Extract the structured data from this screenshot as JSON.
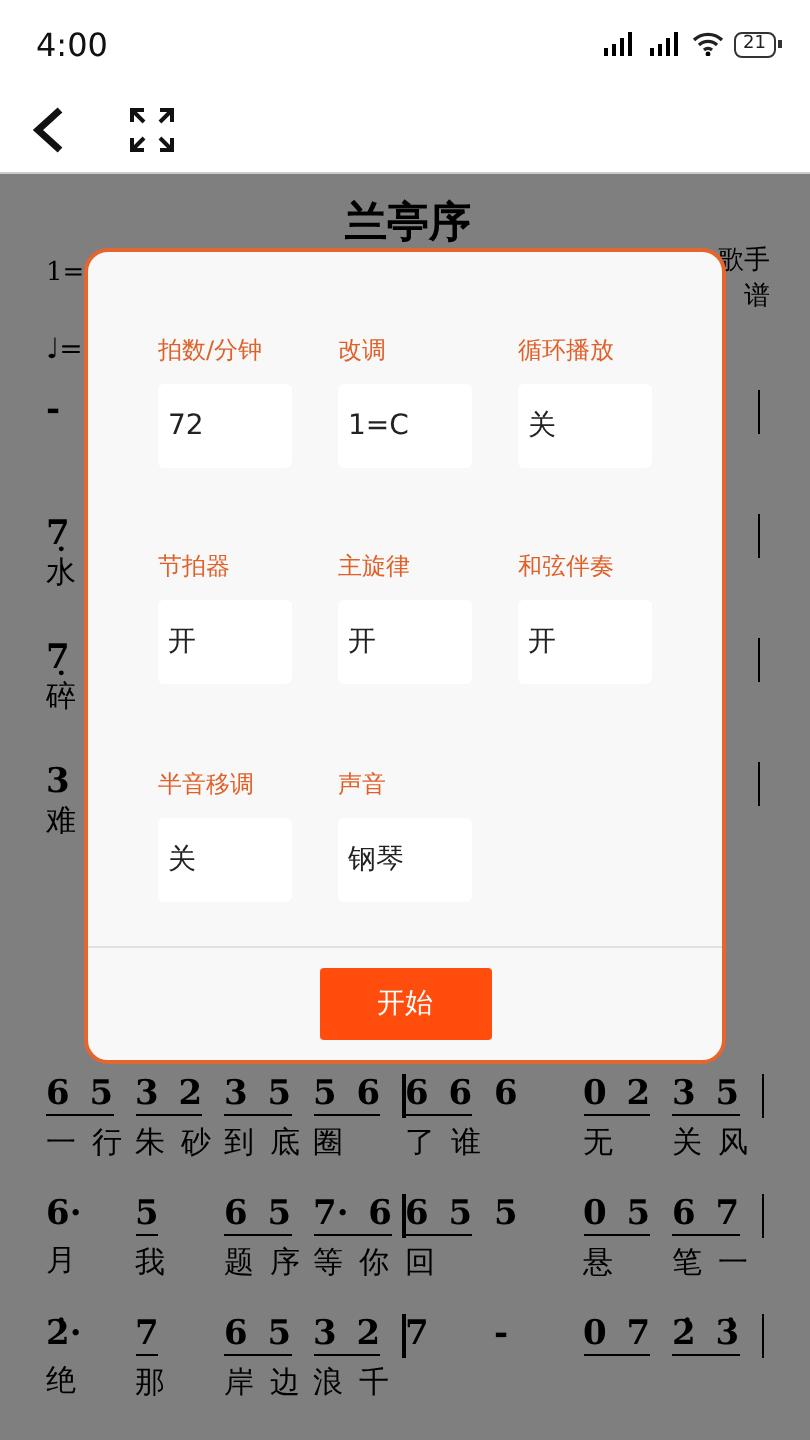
{
  "status_bar": {
    "time": "4:00",
    "battery": "21"
  },
  "score": {
    "title": "兰亭序",
    "key": "1=",
    "tempo": "♩=",
    "credits": [
      "歌手",
      "谱"
    ],
    "fragments": [
      {
        "note": "-"
      },
      {
        "note": "7̣",
        "lyric": "水"
      },
      {
        "note": "7̣",
        "lyric": "碎"
      },
      {
        "note": "3",
        "lyric": "难"
      }
    ],
    "lines": [
      {
        "cells": [
          {
            "notes": "6 5",
            "beam": true,
            "lyric": "一 行"
          },
          {
            "notes": "3 2",
            "beam": true,
            "lyric": "朱 砂"
          },
          {
            "notes": "3 5",
            "beam": true,
            "lyric": "到 底"
          },
          {
            "notes": "5 6",
            "beam": true,
            "lyric": "圈"
          },
          {
            "kind": "bar"
          },
          {
            "notes": "6 6",
            "beam": true,
            "lyric": "了 谁"
          },
          {
            "notes": "6",
            "beam": false
          },
          {
            "notes": "0 2",
            "beam": true,
            "lyric": "无"
          },
          {
            "notes": "3 5",
            "beam": true,
            "lyric": "关 风"
          },
          {
            "kind": "bar"
          }
        ]
      },
      {
        "cells": [
          {
            "notes": "6·",
            "beam": false,
            "lyric": "月"
          },
          {
            "notes": "5",
            "beam": true,
            "lyric": "我"
          },
          {
            "notes": "6 5",
            "beam": true,
            "lyric": "题 序"
          },
          {
            "notes": "7· 6",
            "beam": true,
            "lyric": "等 你"
          },
          {
            "kind": "bar"
          },
          {
            "notes": "6 5",
            "beam": true,
            "lyric": "回"
          },
          {
            "notes": "5",
            "beam": false
          },
          {
            "notes": "0 5",
            "beam": true,
            "lyric": "悬"
          },
          {
            "notes": "6 7",
            "beam": true,
            "lyric": "笔 一"
          },
          {
            "kind": "bar"
          }
        ]
      },
      {
        "cells": [
          {
            "notes": "2̇·",
            "beam": false,
            "lyric": "绝"
          },
          {
            "notes": "7",
            "beam": true,
            "lyric": "那"
          },
          {
            "notes": "6 5",
            "beam": true,
            "lyric": "岸 边"
          },
          {
            "notes": "3 2",
            "beam": true,
            "lyric": "浪 千"
          },
          {
            "kind": "bar"
          },
          {
            "notes": "7",
            "beam": false
          },
          {
            "notes": "-",
            "beam": false
          },
          {
            "notes": "0 7",
            "beam": true
          },
          {
            "notes": "2̇ 3̇",
            "beam": true
          },
          {
            "kind": "bar"
          }
        ]
      }
    ]
  },
  "dialog": {
    "settings": [
      {
        "label": "拍数/分钟",
        "value": "72"
      },
      {
        "label": "改调",
        "value": "1=C"
      },
      {
        "label": "循环播放",
        "value": "关"
      },
      {
        "label": "节拍器",
        "value": "开"
      },
      {
        "label": "主旋律",
        "value": "开"
      },
      {
        "label": "和弦伴奏",
        "value": "开"
      },
      {
        "label": "半音移调",
        "value": "关"
      },
      {
        "label": "声音",
        "value": "钢琴"
      }
    ],
    "start_button": "开始"
  }
}
